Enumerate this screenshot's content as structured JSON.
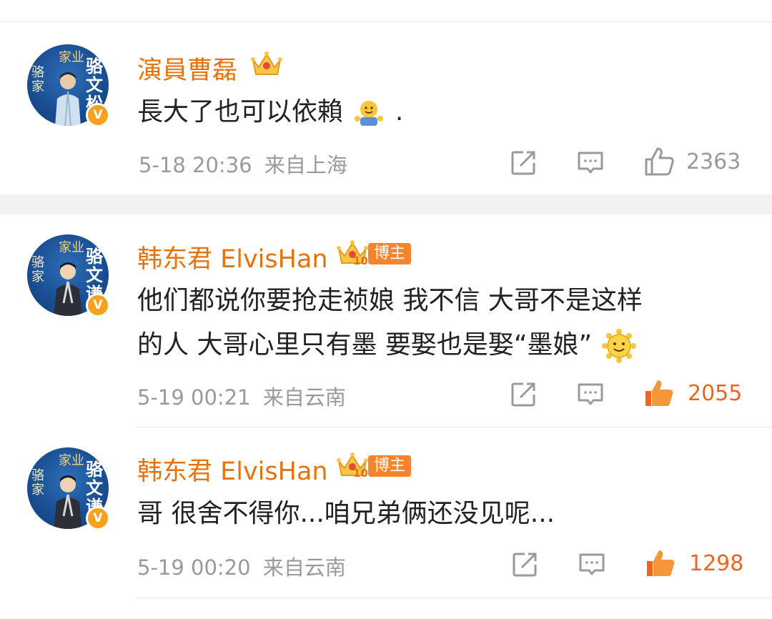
{
  "comments": [
    {
      "avatar": {
        "t1": "家业",
        "t2": "骆家",
        "t3": "骆文松"
      },
      "username": "演員曹磊",
      "text": "長大了也可以依賴",
      "text_suffix": ".",
      "date": "5-18 20:36",
      "location": "来自上海",
      "likes": "2363",
      "liked": false
    },
    {
      "avatar": {
        "t1": "家业",
        "t2": "骆家",
        "t3": "骆文谦"
      },
      "username": "韩东君 ElvisHan",
      "level": "10",
      "tag": "博主",
      "text_line1": "他们都说你要抢走祯娘  我不信  大哥不是这样",
      "text_line2": "的人  大哥心里只有墨  要娶也是娶“墨娘”",
      "date": "5-19 00:21",
      "location": "来自云南",
      "likes": "2055",
      "liked": true
    },
    {
      "avatar": {
        "t1": "家业",
        "t2": "骆家",
        "t3": "骆文谦"
      },
      "username": "韩东君 ElvisHan",
      "level": "10",
      "tag": "博主",
      "text": "哥 很舍不得你...咱兄弟俩还没见呢...",
      "date": "5-19 00:20",
      "location": "来自云南",
      "likes": "1298",
      "liked": true
    }
  ],
  "colors": {
    "username": "#e8720c",
    "liked": "#f0641e",
    "meta": "#9a9a9a",
    "verified": "#f7a21b"
  },
  "icons": [
    "share-icon",
    "comment-icon",
    "like-icon",
    "crown-icon",
    "verified-v-icon"
  ]
}
